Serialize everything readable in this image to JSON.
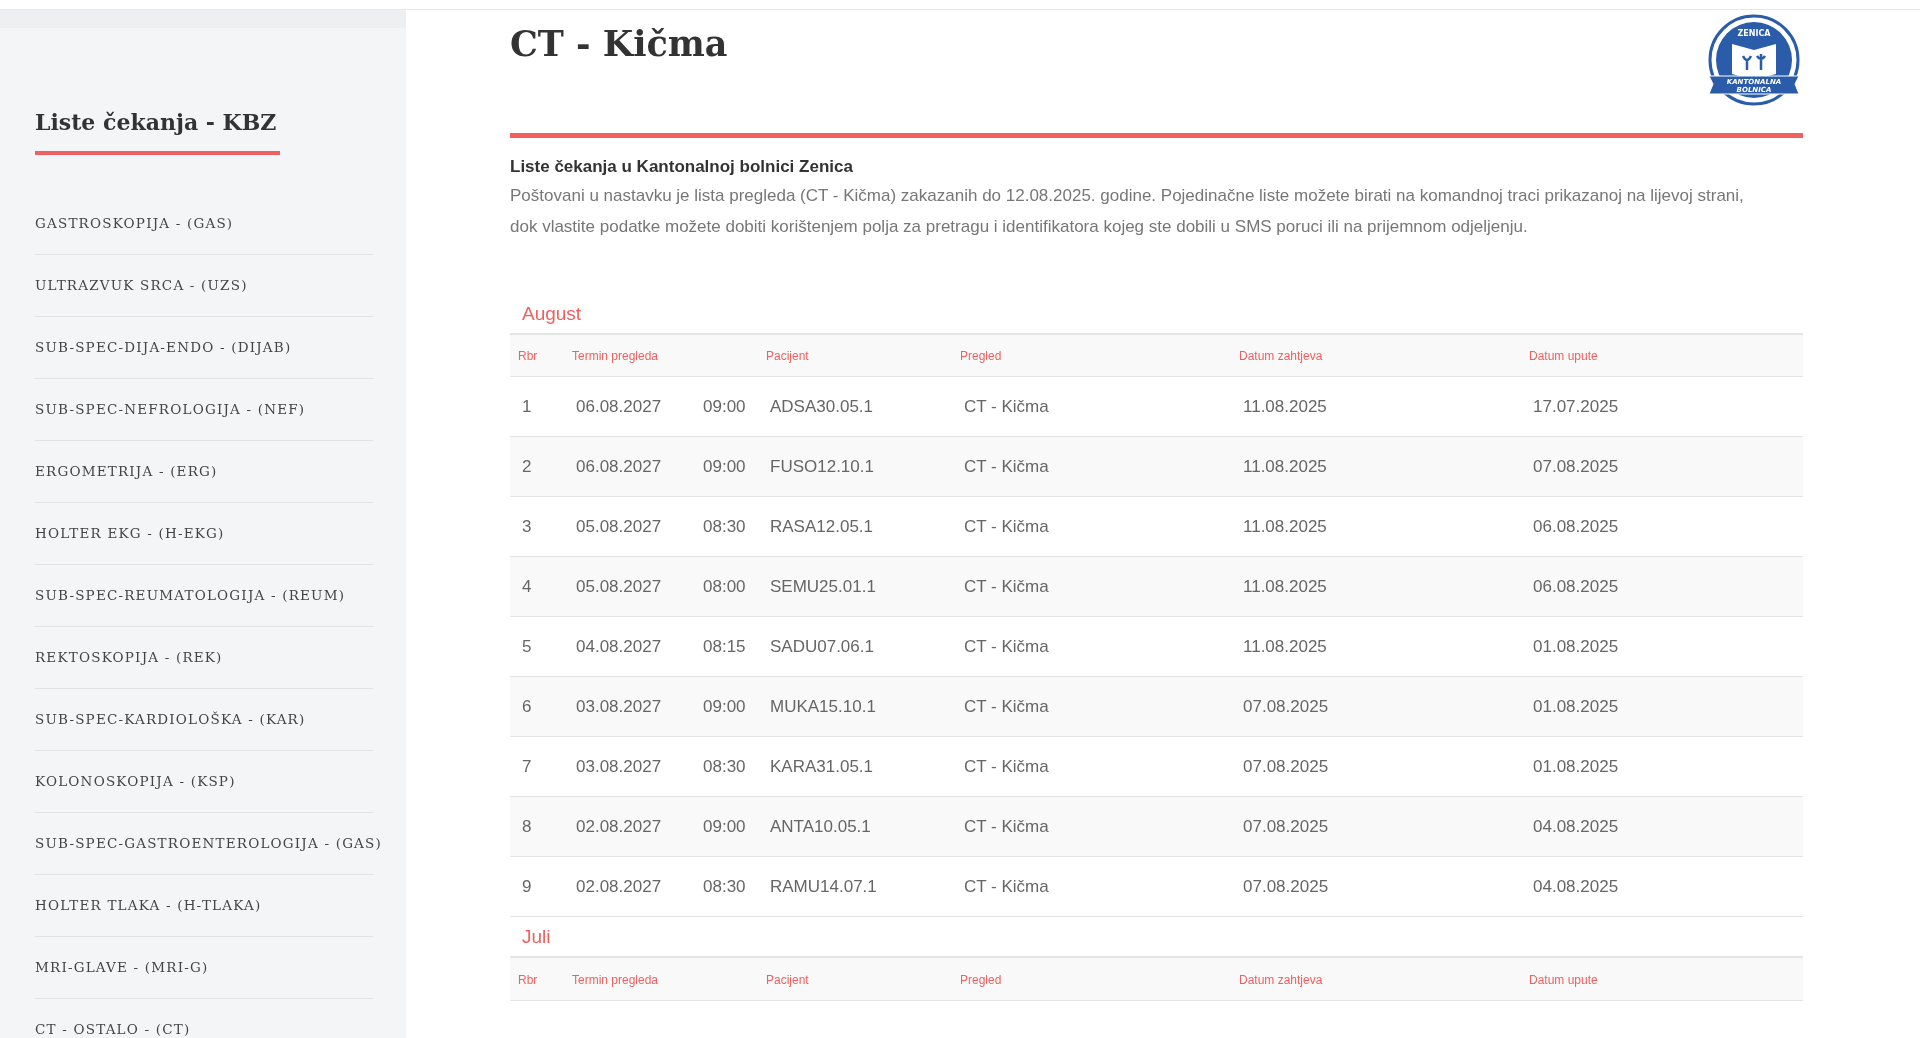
{
  "sidebar": {
    "title": "Liste čekanja - KBZ",
    "items": [
      {
        "label": "GASTROSKOPIJA - (GAS)"
      },
      {
        "label": "ULTRAZVUK SRCA - (UZS)"
      },
      {
        "label": "SUB-SPEC-DIJA-ENDO - (DIJAB)"
      },
      {
        "label": "SUB-SPEC-NEFROLOGIJA - (NEF)"
      },
      {
        "label": "ERGOMETRIJA - (ERG)"
      },
      {
        "label": "HOLTER EKG - (H-EKG)"
      },
      {
        "label": "SUB-SPEC-REUMATOLOGIJA - (REUM)"
      },
      {
        "label": "REKTOSKOPIJA - (REK)"
      },
      {
        "label": "SUB-SPEC-KARDIOLOŠKA - (KAR)"
      },
      {
        "label": "KOLONOSKOPIJA - (KSP)"
      },
      {
        "label": "SUB-SPEC-GASTROENTEROLOGIJA - (GAS)"
      },
      {
        "label": "HOLTER TLAKA - (H-TLAKA)"
      },
      {
        "label": "MRI-GLAVE - (MRI-G)"
      },
      {
        "label": "CT - OSTALO - (CT)"
      }
    ]
  },
  "page": {
    "title": "CT - Kičma",
    "logo": {
      "top_text": "ZENICA",
      "ribbon_lines": [
        "KANTONALNA",
        "BOLNICA"
      ]
    },
    "intro_heading": "Liste čekanja u Kantonalnoj bolnici Zenica",
    "intro_text": "Poštovani u nastavku je lista pregleda (CT - Kičma) zakazanih do 12.08.2025. godine. Pojedinačne liste možete birati na komandnoj traci prikazanoj na lijevoj strani, dok vlastite podatke možete dobiti korištenjem polja za pretragu i identifikatora kojeg ste dobili u SMS poruci ili na prijemnom odjeljenju."
  },
  "months": [
    {
      "name": "August",
      "columns": [
        "Rbr",
        "Termin pregleda",
        "",
        "Pacijent",
        "Pregled",
        "Datum zahtjeva",
        "Datum upute"
      ],
      "rows": [
        [
          "1",
          "06.08.2027",
          "09:00",
          "ADSA30.05.1",
          "CT - Kičma",
          "11.08.2025",
          "17.07.2025"
        ],
        [
          "2",
          "06.08.2027",
          "09:00",
          "FUSO12.10.1",
          "CT - Kičma",
          "11.08.2025",
          "07.08.2025"
        ],
        [
          "3",
          "05.08.2027",
          "08:30",
          "RASA12.05.1",
          "CT - Kičma",
          "11.08.2025",
          "06.08.2025"
        ],
        [
          "4",
          "05.08.2027",
          "08:00",
          "SEMU25.01.1",
          "CT - Kičma",
          "11.08.2025",
          "06.08.2025"
        ],
        [
          "5",
          "04.08.2027",
          "08:15",
          "SADU07.06.1",
          "CT - Kičma",
          "11.08.2025",
          "01.08.2025"
        ],
        [
          "6",
          "03.08.2027",
          "09:00",
          "MUKA15.10.1",
          "CT - Kičma",
          "07.08.2025",
          "01.08.2025"
        ],
        [
          "7",
          "03.08.2027",
          "08:30",
          "KARA31.05.1",
          "CT - Kičma",
          "07.08.2025",
          "01.08.2025"
        ],
        [
          "8",
          "02.08.2027",
          "09:00",
          "ANTA10.05.1",
          "CT - Kičma",
          "07.08.2025",
          "04.08.2025"
        ],
        [
          "9",
          "02.08.2027",
          "08:30",
          "RAMU14.07.1",
          "CT - Kičma",
          "07.08.2025",
          "04.08.2025"
        ]
      ]
    },
    {
      "name": "Juli",
      "columns": [
        "Rbr",
        "Termin pregleda",
        "",
        "Pacijent",
        "Pregled",
        "Datum zahtjeva",
        "Datum upute"
      ]
    }
  ]
}
